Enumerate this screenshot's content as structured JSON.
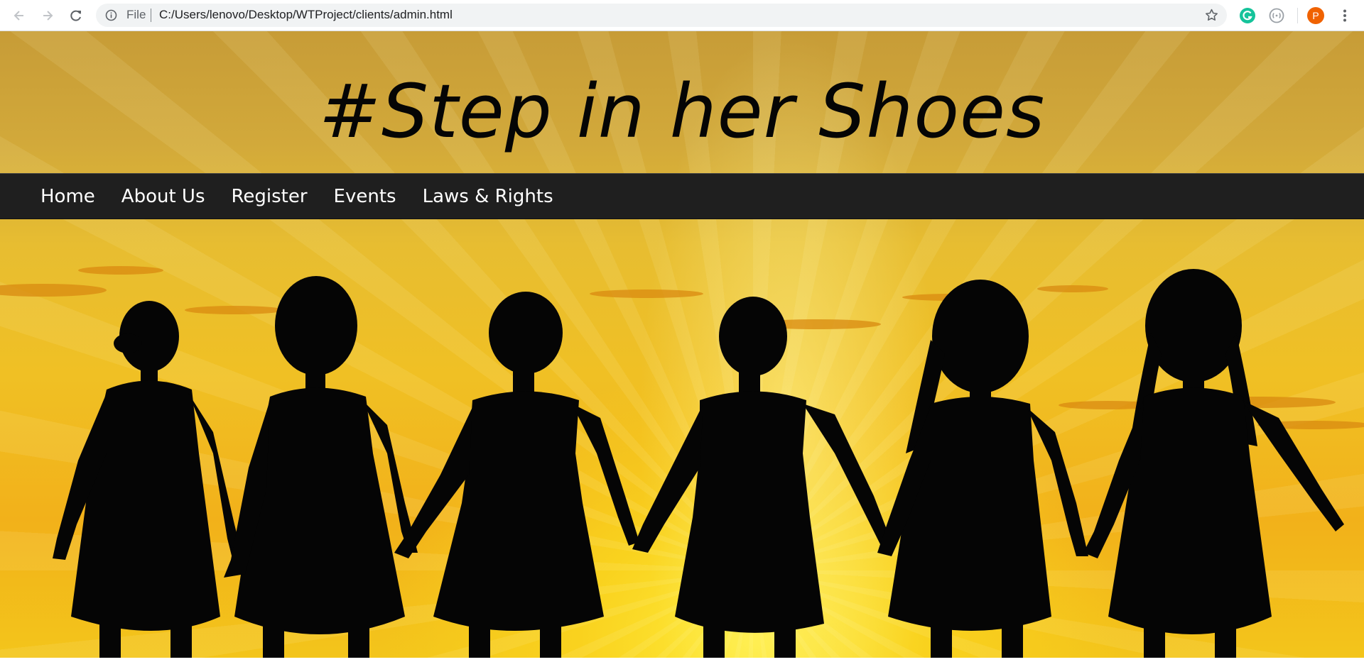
{
  "browser": {
    "file_label": "File",
    "url": "C:/Users/lenovo/Desktop/WTProject/clients/admin.html",
    "profile_initial": "P",
    "icons": [
      "back-arrow-icon",
      "forward-arrow-icon",
      "reload-icon",
      "info-icon",
      "star-icon",
      "grammarly-icon",
      "extension-icon",
      "profile-avatar",
      "more-menu-icon"
    ]
  },
  "site": {
    "title": "#Step in her Shoes",
    "nav": [
      {
        "label": "Home"
      },
      {
        "label": "About Us"
      },
      {
        "label": "Register"
      },
      {
        "label": "Events"
      },
      {
        "label": "Laws & Rights"
      }
    ]
  },
  "colors": {
    "navbar": "#1f1f1f",
    "sky_top": "#c79c37",
    "sky_glow": "#ffec3b",
    "silhouette": "#050505",
    "profile": "#f06200",
    "grammarly": "#15c39a"
  }
}
